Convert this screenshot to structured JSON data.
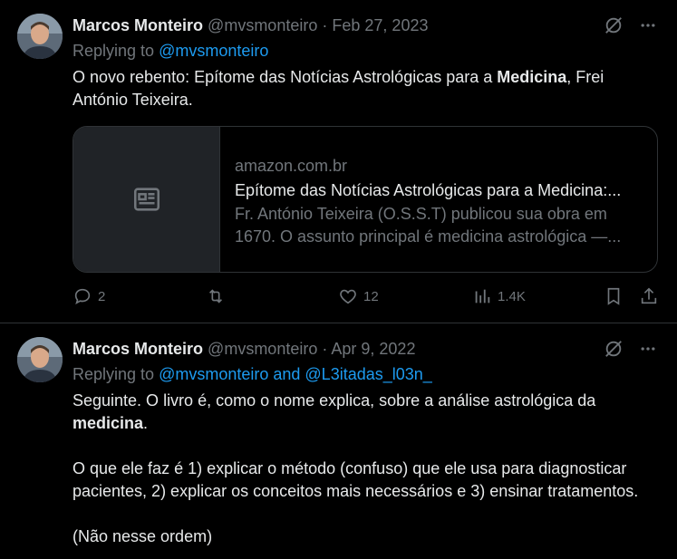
{
  "tweets": [
    {
      "author_name": "Marcos Monteiro",
      "handle": "@mvsmonteiro",
      "separator": "·",
      "date": "Feb 27, 2023",
      "replying_prefix": "Replying to",
      "replying_to": "@mvsmonteiro",
      "text_part1": "O novo rebento: Epítome das Notícias Astrológicas para a ",
      "text_bold": "Medicina",
      "text_part2": ", Frei António Teixeira.",
      "card": {
        "domain": "amazon.com.br",
        "title": "Epítome das Notícias Astrológicas para a Medicina:...",
        "description": "Fr. António Teixeira (O.S.S.T) publicou sua obra em 1670. O assunto principal é medicina astrológica —..."
      },
      "actions": {
        "replies": "2",
        "retweets": "",
        "likes": "12",
        "views": "1.4K"
      }
    },
    {
      "author_name": "Marcos Monteiro",
      "handle": "@mvsmonteiro",
      "separator": "·",
      "date": "Apr 9, 2022",
      "replying_prefix": "Replying to",
      "replying_to": "@mvsmonteiro and @L3itadas_l03n_",
      "p1_part1": "Seguinte. O livro é, como o nome explica, sobre a análise astrológica da ",
      "p1_bold": "medicina",
      "p1_part2": ".",
      "p2": "O que ele faz é 1) explicar o método (confuso) que ele usa para diagnosticar pacientes, 2) explicar os conceitos mais necessários e 3) ensinar tratamentos.",
      "p3": "(Não nesse ordem)"
    }
  ],
  "icons": {
    "grok": "grok-icon",
    "more": "more-icon",
    "reply": "reply-icon",
    "retweet": "retweet-icon",
    "like": "like-icon",
    "views": "views-icon",
    "bookmark": "bookmark-icon",
    "share": "share-icon",
    "article": "article-icon"
  },
  "colors": {
    "background": "#000000",
    "text": "#e7e9ea",
    "muted": "#71767b",
    "link": "#1d9bf0",
    "border": "#2f3336"
  }
}
